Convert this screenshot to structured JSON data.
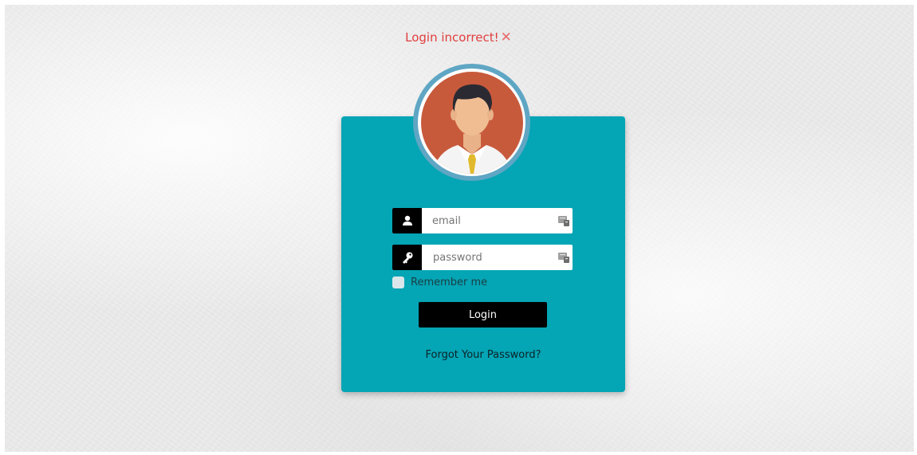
{
  "alert": {
    "message": "Login incorrect!",
    "close_glyph": "✕",
    "color": "#e23d3d"
  },
  "avatar": {
    "icon": "user-avatar-icon"
  },
  "form": {
    "email": {
      "placeholder": "email",
      "value": "",
      "icon": "user-icon"
    },
    "password": {
      "placeholder": "password",
      "value": "",
      "icon": "key-icon"
    },
    "remember_label": "Remember me",
    "login_label": "Login",
    "forgot_label": "Forgot Your Password?"
  },
  "colors": {
    "card": "#04a5b5",
    "button": "#000000",
    "avatar_ring": "#5fa6c4",
    "avatar_bg": "#c85a3c"
  }
}
